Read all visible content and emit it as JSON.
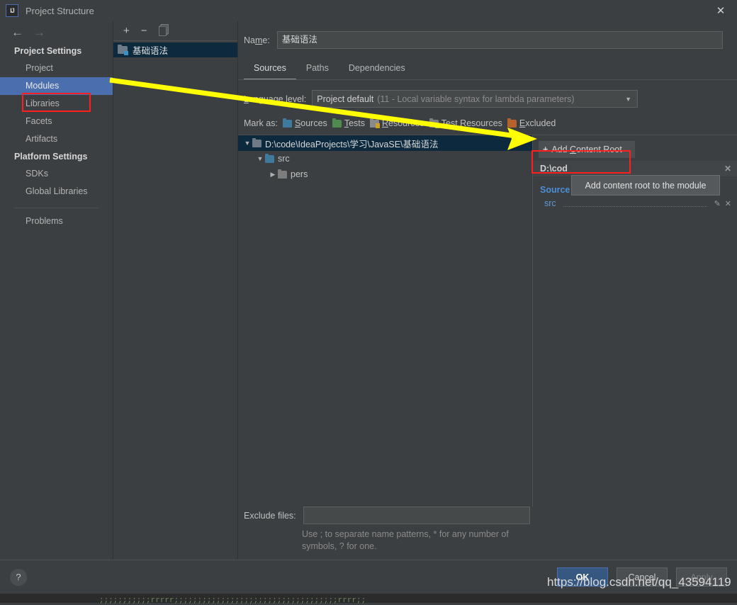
{
  "window": {
    "title": "Project Structure",
    "logo_text": "IJ",
    "close_icon": "close-icon"
  },
  "nav": {
    "back_icon": "arrow-left-icon",
    "forward_icon": "arrow-right-icon"
  },
  "sidebar": {
    "groups": [
      {
        "title": "Project Settings",
        "items": [
          {
            "label": "Project",
            "selected": false
          },
          {
            "label": "Modules",
            "selected": true
          },
          {
            "label": "Libraries",
            "selected": false
          },
          {
            "label": "Facets",
            "selected": false
          },
          {
            "label": "Artifacts",
            "selected": false
          }
        ]
      },
      {
        "title": "Platform Settings",
        "items": [
          {
            "label": "SDKs",
            "selected": false
          },
          {
            "label": "Global Libraries",
            "selected": false
          }
        ]
      }
    ],
    "footer_items": [
      {
        "label": "Problems",
        "selected": false
      }
    ]
  },
  "module_list": {
    "toolbar": {
      "add_icon": "plus-icon",
      "remove_icon": "minus-icon",
      "copy_icon": "copy-icon"
    },
    "items": [
      {
        "label": "基础语法",
        "selected": true
      }
    ]
  },
  "main": {
    "name_label": "Name:",
    "name_label_prefix": "Na",
    "name_label_accel": "m",
    "name_label_suffix": "e:",
    "name_value": "基础语法",
    "tabs": [
      {
        "label": "Sources",
        "active": true
      },
      {
        "label": "Paths",
        "active": false
      },
      {
        "label": "Dependencies",
        "active": false
      }
    ],
    "language_level": {
      "label_prefix": "",
      "label_accel": "L",
      "label_suffix": "anguage level:",
      "value": "Project default",
      "value_detail": "(11 - Local variable syntax for lambda parameters)",
      "arrow_icon": "chevron-down-icon"
    },
    "mark_as": {
      "label": "Mark as:",
      "options": [
        {
          "label": "Sources",
          "accel": "S",
          "rest": "ources",
          "color": "#3d7a9e",
          "icon": "folder-sources-icon"
        },
        {
          "label": "Tests",
          "accel": "T",
          "rest": "ests",
          "color": "#4f8a4f",
          "icon": "folder-tests-icon"
        },
        {
          "label": "Resources",
          "accel": "R",
          "rest": "esources",
          "color": "#8a8a8a",
          "icon": "folder-resources-icon"
        },
        {
          "label": "Test Resources",
          "accel": "",
          "rest": "Test Resources",
          "color": "#7f7f7f",
          "icon": "folder-test-resources-icon"
        },
        {
          "label": "Excluded",
          "accel": "E",
          "rest": "xcluded",
          "color": "#b5622c",
          "icon": "folder-excluded-icon"
        }
      ]
    },
    "tree": [
      {
        "label": "D:\\code\\IdeaProjects\\学习\\JavaSE\\基础语法",
        "depth": 0,
        "expanded": true,
        "selected": true,
        "icon": "folder-content-root-icon"
      },
      {
        "label": "src",
        "depth": 1,
        "expanded": true,
        "selected": false,
        "icon": "folder-sources-icon"
      },
      {
        "label": "pers",
        "depth": 2,
        "expanded": false,
        "selected": false,
        "icon": "folder-package-icon"
      }
    ],
    "right_panel": {
      "add_content_root": {
        "plus": "+",
        "label_prefix": "Add ",
        "label_accel": "C",
        "label_suffix": "ontent Root",
        "icon": "plus-icon"
      },
      "root_header_text": "D:\\cod",
      "root_header_close_icon": "close-icon",
      "source_folders_title": "Source Folders",
      "source_folders": [
        {
          "name": "src",
          "edit_icon": "pencil-icon",
          "remove_icon": "close-icon"
        }
      ]
    },
    "exclude": {
      "label": "Exclude files:",
      "value": "",
      "hint_line1": "Use ; to separate name patterns, * for any number of",
      "hint_line2": "symbols, ? for one."
    }
  },
  "tooltip": {
    "text": "Add content root to the module"
  },
  "footer": {
    "help_icon": "help-icon",
    "help_label": "?",
    "buttons": [
      {
        "label": "OK",
        "style": "primary"
      },
      {
        "label": "Cancel",
        "style": "normal"
      },
      {
        "label": "Apply",
        "style": "disabled"
      }
    ]
  },
  "annotations": {
    "highlight_color": "#ff1f1f",
    "arrow_color": "#ffff00",
    "watermark": "https://blog.csdn.net/qq_43594119"
  },
  "background": {
    "gutter_code": "·\n;\nr\nr\ni\ni\ni\ni\ni\nr\nr\n;",
    "bottom_code": ";;;;;;;;;;;rrrrr;;;;;;;;;;;;;;;;;;;;;;;;;;;;;;;;;;;rrrr;;"
  }
}
